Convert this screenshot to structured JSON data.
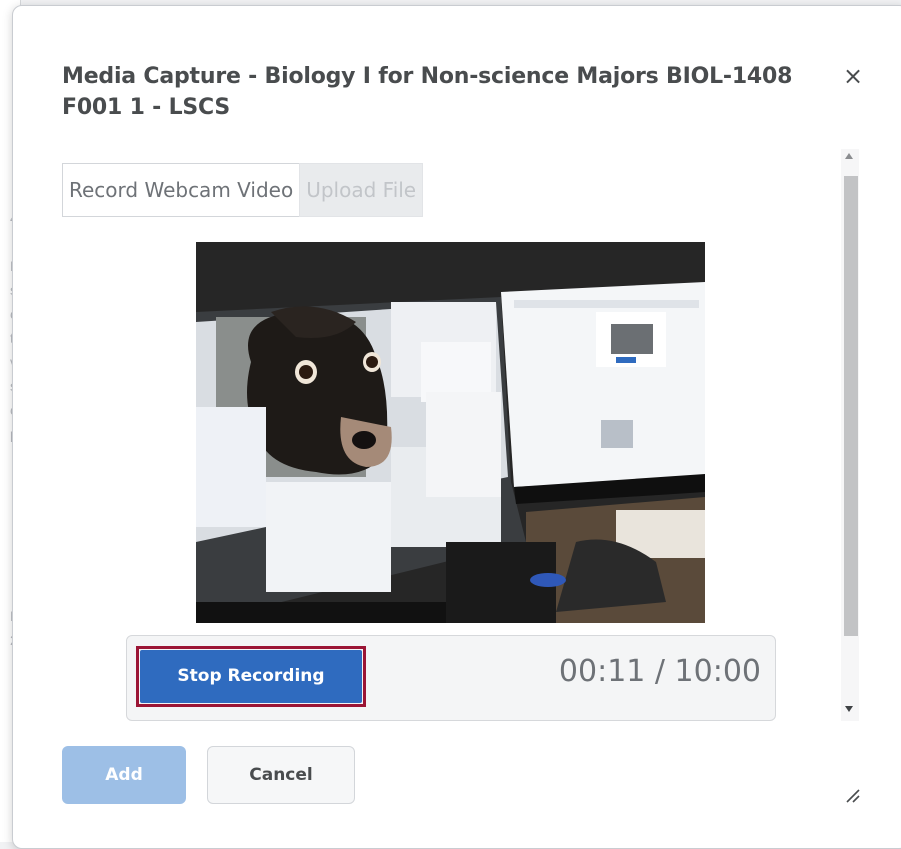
{
  "background_fragments": [
    "4",
    "L",
    "s",
    "c",
    "t",
    "v",
    "s",
    "c",
    "p",
    "E",
    "2"
  ],
  "dialog": {
    "title": "Media Capture - Biology I for Non-science Majors BIOL-1408 F001 1 - LSCS",
    "close_icon": "close-icon",
    "close_glyph": "×"
  },
  "tabs": [
    {
      "label": "Record Webcam Video",
      "state": "active"
    },
    {
      "label": "Upload File",
      "state": "disabled"
    }
  ],
  "recording": {
    "stop_label": "Stop Recording",
    "timer": "00:11 / 10:00",
    "elapsed": "00:11",
    "limit": "10:00"
  },
  "footer": {
    "add_label": "Add",
    "cancel_label": "Cancel"
  },
  "colors": {
    "primary": "#2f6bbf",
    "primary_disabled": "#9dbfe6",
    "highlight_outline": "#9b1535",
    "text": "#494c4e"
  },
  "icons": {
    "close": "close-icon",
    "scroll_up": "arrow-up-icon",
    "scroll_down": "arrow-down-icon",
    "resize": "resize-grip-icon"
  }
}
